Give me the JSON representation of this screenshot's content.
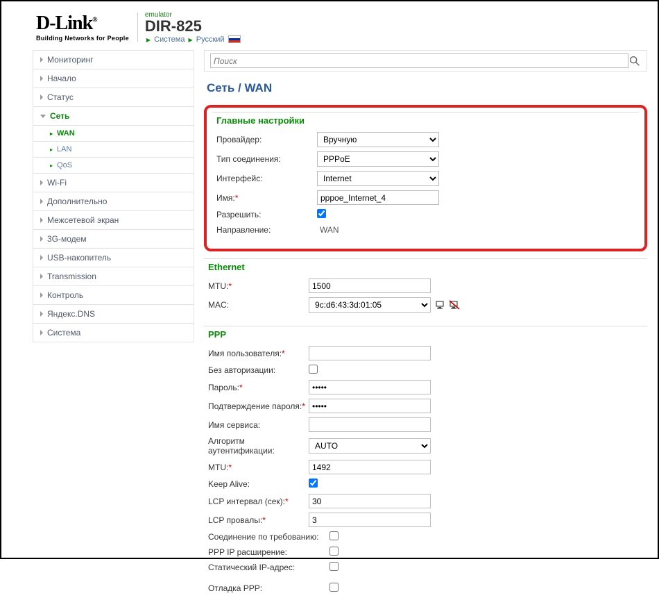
{
  "header": {
    "logo": "D-Link",
    "logo_tag": "Building Networks for People",
    "emulator": "emulator",
    "model": "DIR-825",
    "crumb1": "Система",
    "crumb2": "Русский"
  },
  "search": {
    "placeholder": "Поиск"
  },
  "sidebar": {
    "items": [
      "Мониторинг",
      "Начало",
      "Статус",
      "Сеть",
      "Wi-Fi",
      "Дополнительно",
      "Межсетевой экран",
      "3G-модем",
      "USB-накопитель",
      "Transmission",
      "Контроль",
      "Яндекс.DNS",
      "Система"
    ],
    "sub": [
      "WAN",
      "LAN",
      "QoS"
    ]
  },
  "page_title": "Сеть  /  WAN",
  "sections": {
    "main": {
      "title": "Главные настройки",
      "provider_label": "Провайдер:",
      "provider_value": "Вручную",
      "conn_type_label": "Тип соединения:",
      "conn_type_value": "PPPoE",
      "iface_label": "Интерфейс:",
      "iface_value": "Internet",
      "name_label": "Имя:",
      "name_value": "pppoe_Internet_4",
      "allow_label": "Разрешить:",
      "direction_label": "Направление:",
      "direction_value": "WAN"
    },
    "ethernet": {
      "title": "Ethernet",
      "mtu_label": "MTU:",
      "mtu_value": "1500",
      "mac_label": "MAC:",
      "mac_value": "9c:d6:43:3d:01:05"
    },
    "ppp": {
      "title": "PPP",
      "user_label": "Имя пользователя:",
      "noauth_label": "Без авторизации:",
      "password_label": "Пароль:",
      "password_value": "•••••",
      "confirm_label": "Подтверждение пароля:",
      "confirm_value": "•••••",
      "service_label": "Имя сервиса:",
      "auth_label": "Алгоритм аутентификации:",
      "auth_value": "AUTO",
      "mtu_label": "MTU:",
      "mtu_value": "1492",
      "keepalive_label": "Keep Alive:",
      "lcp_interval_label": "LCP интервал (сек):",
      "lcp_interval_value": "30",
      "lcp_fail_label": "LCP провалы:",
      "lcp_fail_value": "3",
      "ondemand_label": "Соединение по требованию:",
      "pppip_label": "PPP IP расширение:",
      "static_label": "Статический IP-адрес:",
      "debug_label": "Отладка PPP:"
    }
  }
}
